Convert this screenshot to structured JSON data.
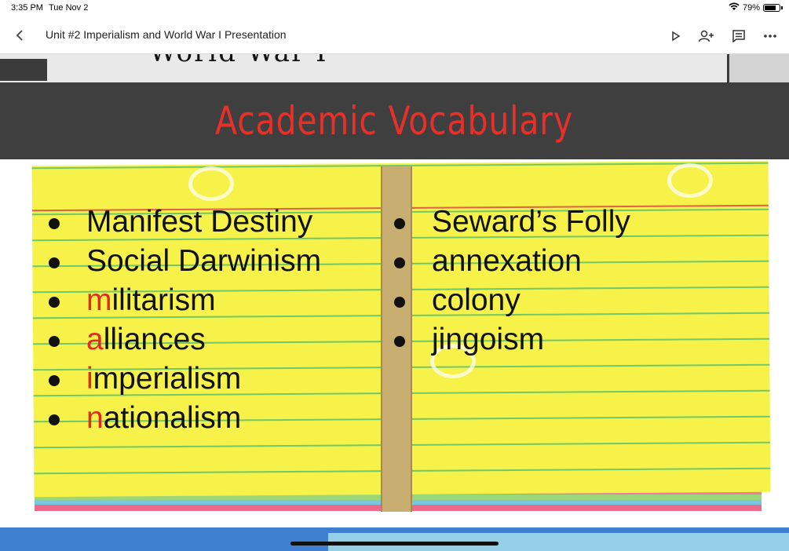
{
  "status_bar": {
    "time": "3:35 PM",
    "date": "Tue Nov 2",
    "battery_text": "79%",
    "battery_level": 0.79
  },
  "toolbar": {
    "back_icon": "chevron-left-icon",
    "title": "Unit #2 Imperialism and World War I Presentation",
    "icons": [
      "play-icon",
      "add-person-icon",
      "comment-icon",
      "more-icon"
    ]
  },
  "slide": {
    "partial_title": "World War I",
    "heading": "Academic Vocabulary",
    "colors": {
      "heading": "#e8302a",
      "banner": "#3f3f3f",
      "card": "#f6f24a",
      "accent_letter": "#e02a20"
    },
    "left_column": [
      {
        "lead": "",
        "rest": "Manifest Destiny"
      },
      {
        "lead": "",
        "rest": "Social Darwinism"
      },
      {
        "lead": "m",
        "rest": "ilitarism"
      },
      {
        "lead": "a",
        "rest": "lliances"
      },
      {
        "lead": "i",
        "rest": "mperialism"
      },
      {
        "lead": "n",
        "rest": "ationalism"
      }
    ],
    "right_column": [
      {
        "lead": "",
        "rest": "Seward’s Folly"
      },
      {
        "lead": "",
        "rest": "annexation"
      },
      {
        "lead": "",
        "rest": "colony"
      },
      {
        "lead": "",
        "rest": "jingoism"
      }
    ]
  }
}
